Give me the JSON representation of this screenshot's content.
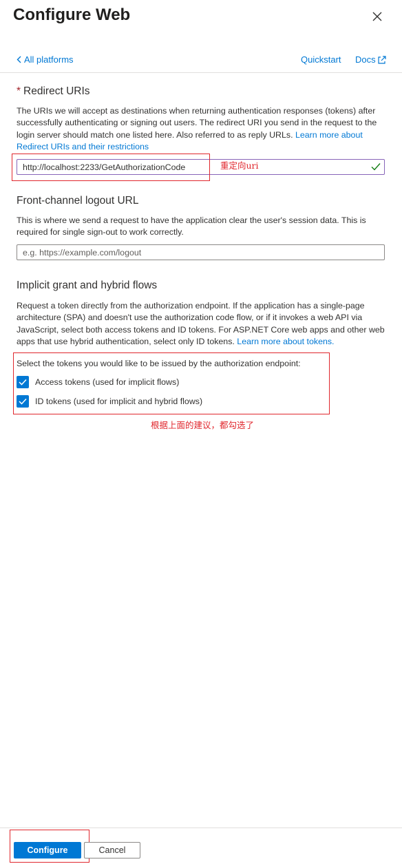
{
  "header": {
    "title": "Configure Web",
    "close_icon": "close-icon"
  },
  "nav": {
    "back_label": "All platforms",
    "back_icon": "chevron-left-icon",
    "quickstart_label": "Quickstart",
    "docs_label": "Docs",
    "docs_icon": "external-link-icon"
  },
  "redirect": {
    "required_mark": "*",
    "title": "Redirect URIs",
    "description": "The URIs we will accept as destinations when returning authentication responses (tokens) after successfully authenticating or signing out users. The redirect URI you send in the request to the login server should match one listed here. Also referred to as reply URLs.",
    "learn_more": "Learn more about Redirect URIs and their restrictions",
    "input_value": "http://localhost:2233/GetAuthorizationCode",
    "valid_icon": "checkmark-icon"
  },
  "logout": {
    "title": "Front-channel logout URL",
    "description": "This is where we send a request to have the application clear the user's session data. This is required for single sign-out to work correctly.",
    "placeholder": "e.g. https://example.com/logout"
  },
  "implicit": {
    "title": "Implicit grant and hybrid flows",
    "description": "Request a token directly from the authorization endpoint. If the application has a single-page architecture (SPA) and doesn't use the authorization code flow, or if it invokes a web API via JavaScript, select both access tokens and ID tokens. For ASP.NET Core web apps and other web apps that use hybrid authentication, select only ID tokens.",
    "learn_more": "Learn more about tokens.",
    "select_label": "Select the tokens you would like to be issued by the authorization endpoint:",
    "options": [
      {
        "label": "Access tokens (used for implicit flows)",
        "checked": true
      },
      {
        "label": "ID tokens (used for implicit and hybrid flows)",
        "checked": true
      }
    ]
  },
  "annotations": {
    "redirect_note": "重定向uri",
    "tokens_note": "根据上面的建议，都勾选了",
    "color": "#e0262c"
  },
  "footer": {
    "configure_label": "Configure",
    "cancel_label": "Cancel"
  },
  "colors": {
    "accent": "#0078d4",
    "valid_border": "#8764b8",
    "valid_check": "#107c10"
  }
}
